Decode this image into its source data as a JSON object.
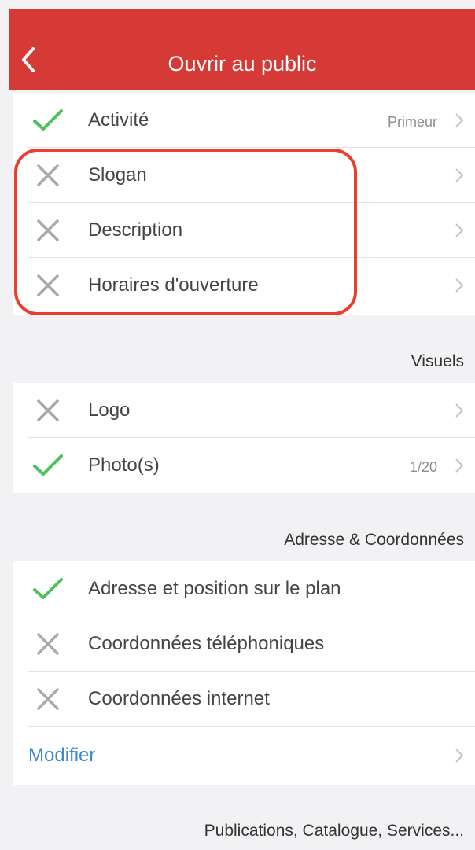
{
  "navbar": {
    "title": "Ouvrir au public"
  },
  "groups": [
    {
      "rows": [
        {
          "status": "check",
          "label": "Activité",
          "value": "Primeur"
        },
        {
          "status": "cross",
          "label": "Slogan",
          "value": ""
        },
        {
          "status": "cross",
          "label": "Description",
          "value": ""
        },
        {
          "status": "cross",
          "label": "Horaires d'ouverture",
          "value": ""
        }
      ]
    },
    {
      "header": "Visuels",
      "rows": [
        {
          "status": "cross",
          "label": "Logo",
          "value": ""
        },
        {
          "status": "check",
          "label": "Photo(s)",
          "value": "1/20"
        }
      ]
    },
    {
      "header": "Adresse & Coordonnées",
      "rows": [
        {
          "status": "check",
          "label": "Adresse et position sur le plan"
        },
        {
          "status": "cross",
          "label": "Coordonnées téléphoniques"
        },
        {
          "status": "cross",
          "label": "Coordonnées internet"
        },
        {
          "label": "Modifier"
        }
      ]
    },
    {
      "header": "Publications, Catalogue, Services..."
    }
  ],
  "colors": {
    "navbar": "#d63a36",
    "check": "#4cc25a",
    "cross": "#a8a8ad",
    "link": "#3d86d8",
    "highlight": "#e8402a"
  },
  "icons": {
    "back": "chevron-left-icon",
    "check": "checkmark-icon",
    "cross": "cross-icon",
    "disclosure": "chevron-right-icon"
  }
}
